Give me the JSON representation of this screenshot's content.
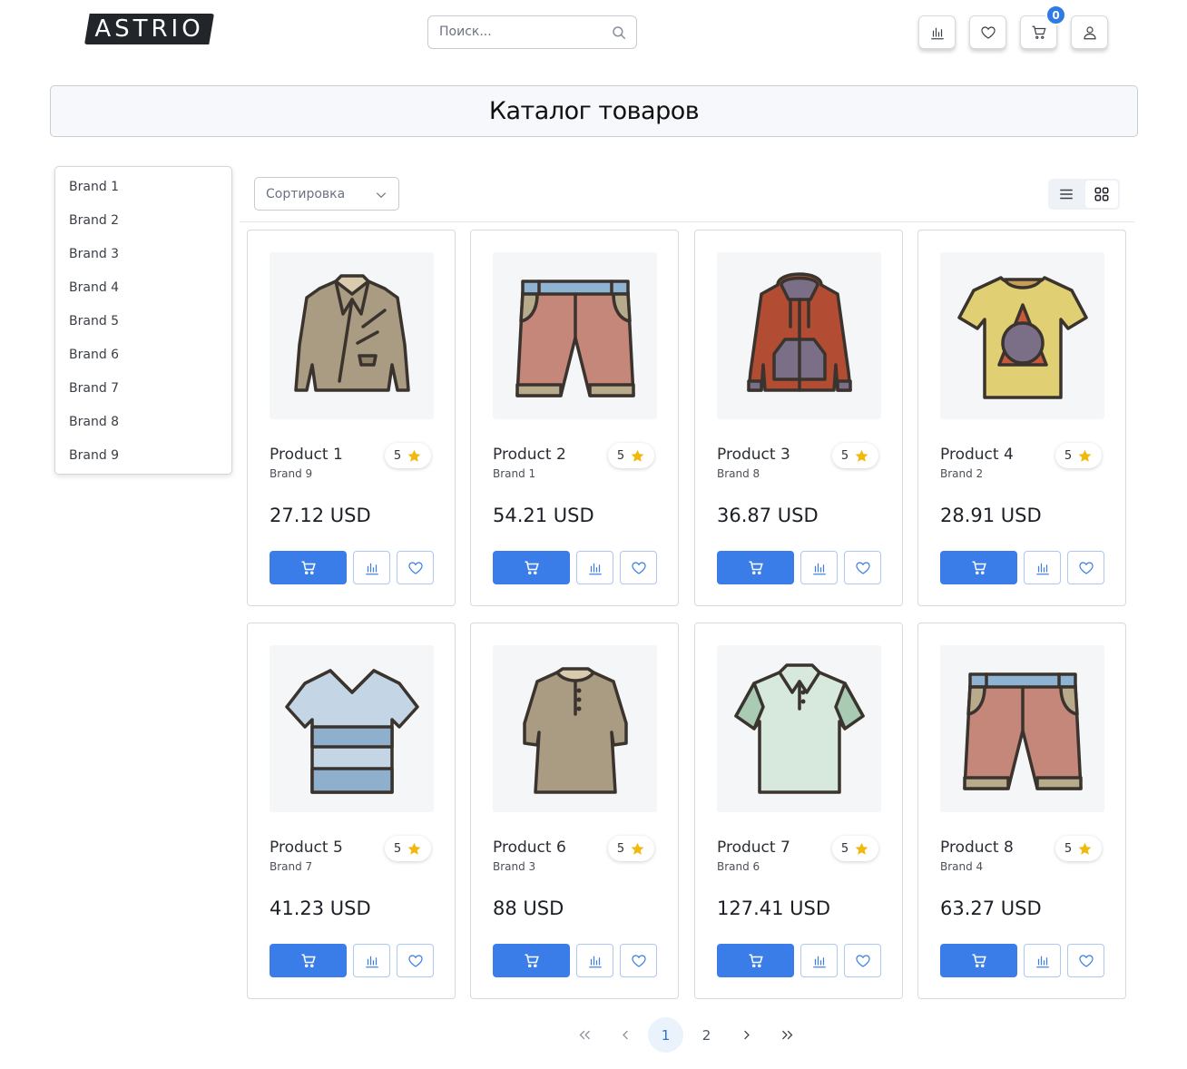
{
  "header": {
    "logo_text": "ASTRIO",
    "search_placeholder": "Поиск...",
    "cart_count": "0"
  },
  "page_title": "Каталог товаров",
  "brands": [
    "Brand 1",
    "Brand 2",
    "Brand 3",
    "Brand 4",
    "Brand 5",
    "Brand 6",
    "Brand 7",
    "Brand 8",
    "Brand 9"
  ],
  "toolbar": {
    "sort_label": "Сортировка",
    "view_mode": "grid"
  },
  "products": [
    {
      "name": "Product 1",
      "brand": "Brand 9",
      "rating": "5",
      "price": "27.12 USD",
      "image": "leather-jacket"
    },
    {
      "name": "Product 2",
      "brand": "Brand 1",
      "rating": "5",
      "price": "54.21 USD",
      "image": "shorts"
    },
    {
      "name": "Product 3",
      "brand": "Brand 8",
      "rating": "5",
      "price": "36.87 USD",
      "image": "hoodie"
    },
    {
      "name": "Product 4",
      "brand": "Brand 2",
      "rating": "5",
      "price": "28.91 USD",
      "image": "triangle-tshirt"
    },
    {
      "name": "Product 5",
      "brand": "Brand 7",
      "rating": "5",
      "price": "41.23 USD",
      "image": "striped-tshirt"
    },
    {
      "name": "Product 6",
      "brand": "Brand 3",
      "rating": "5",
      "price": "88 USD",
      "image": "henley-shirt"
    },
    {
      "name": "Product 7",
      "brand": "Brand 6",
      "rating": "5",
      "price": "127.41 USD",
      "image": "polo-shirt"
    },
    {
      "name": "Product 8",
      "brand": "Brand 4",
      "rating": "5",
      "price": "63.27 USD",
      "image": "shorts"
    }
  ],
  "pagination": {
    "pages": [
      "1",
      "2"
    ],
    "current": "1"
  },
  "colors": {
    "accent": "#3a7de8",
    "star": "#f0b90b",
    "logo_bg": "#22252a"
  }
}
